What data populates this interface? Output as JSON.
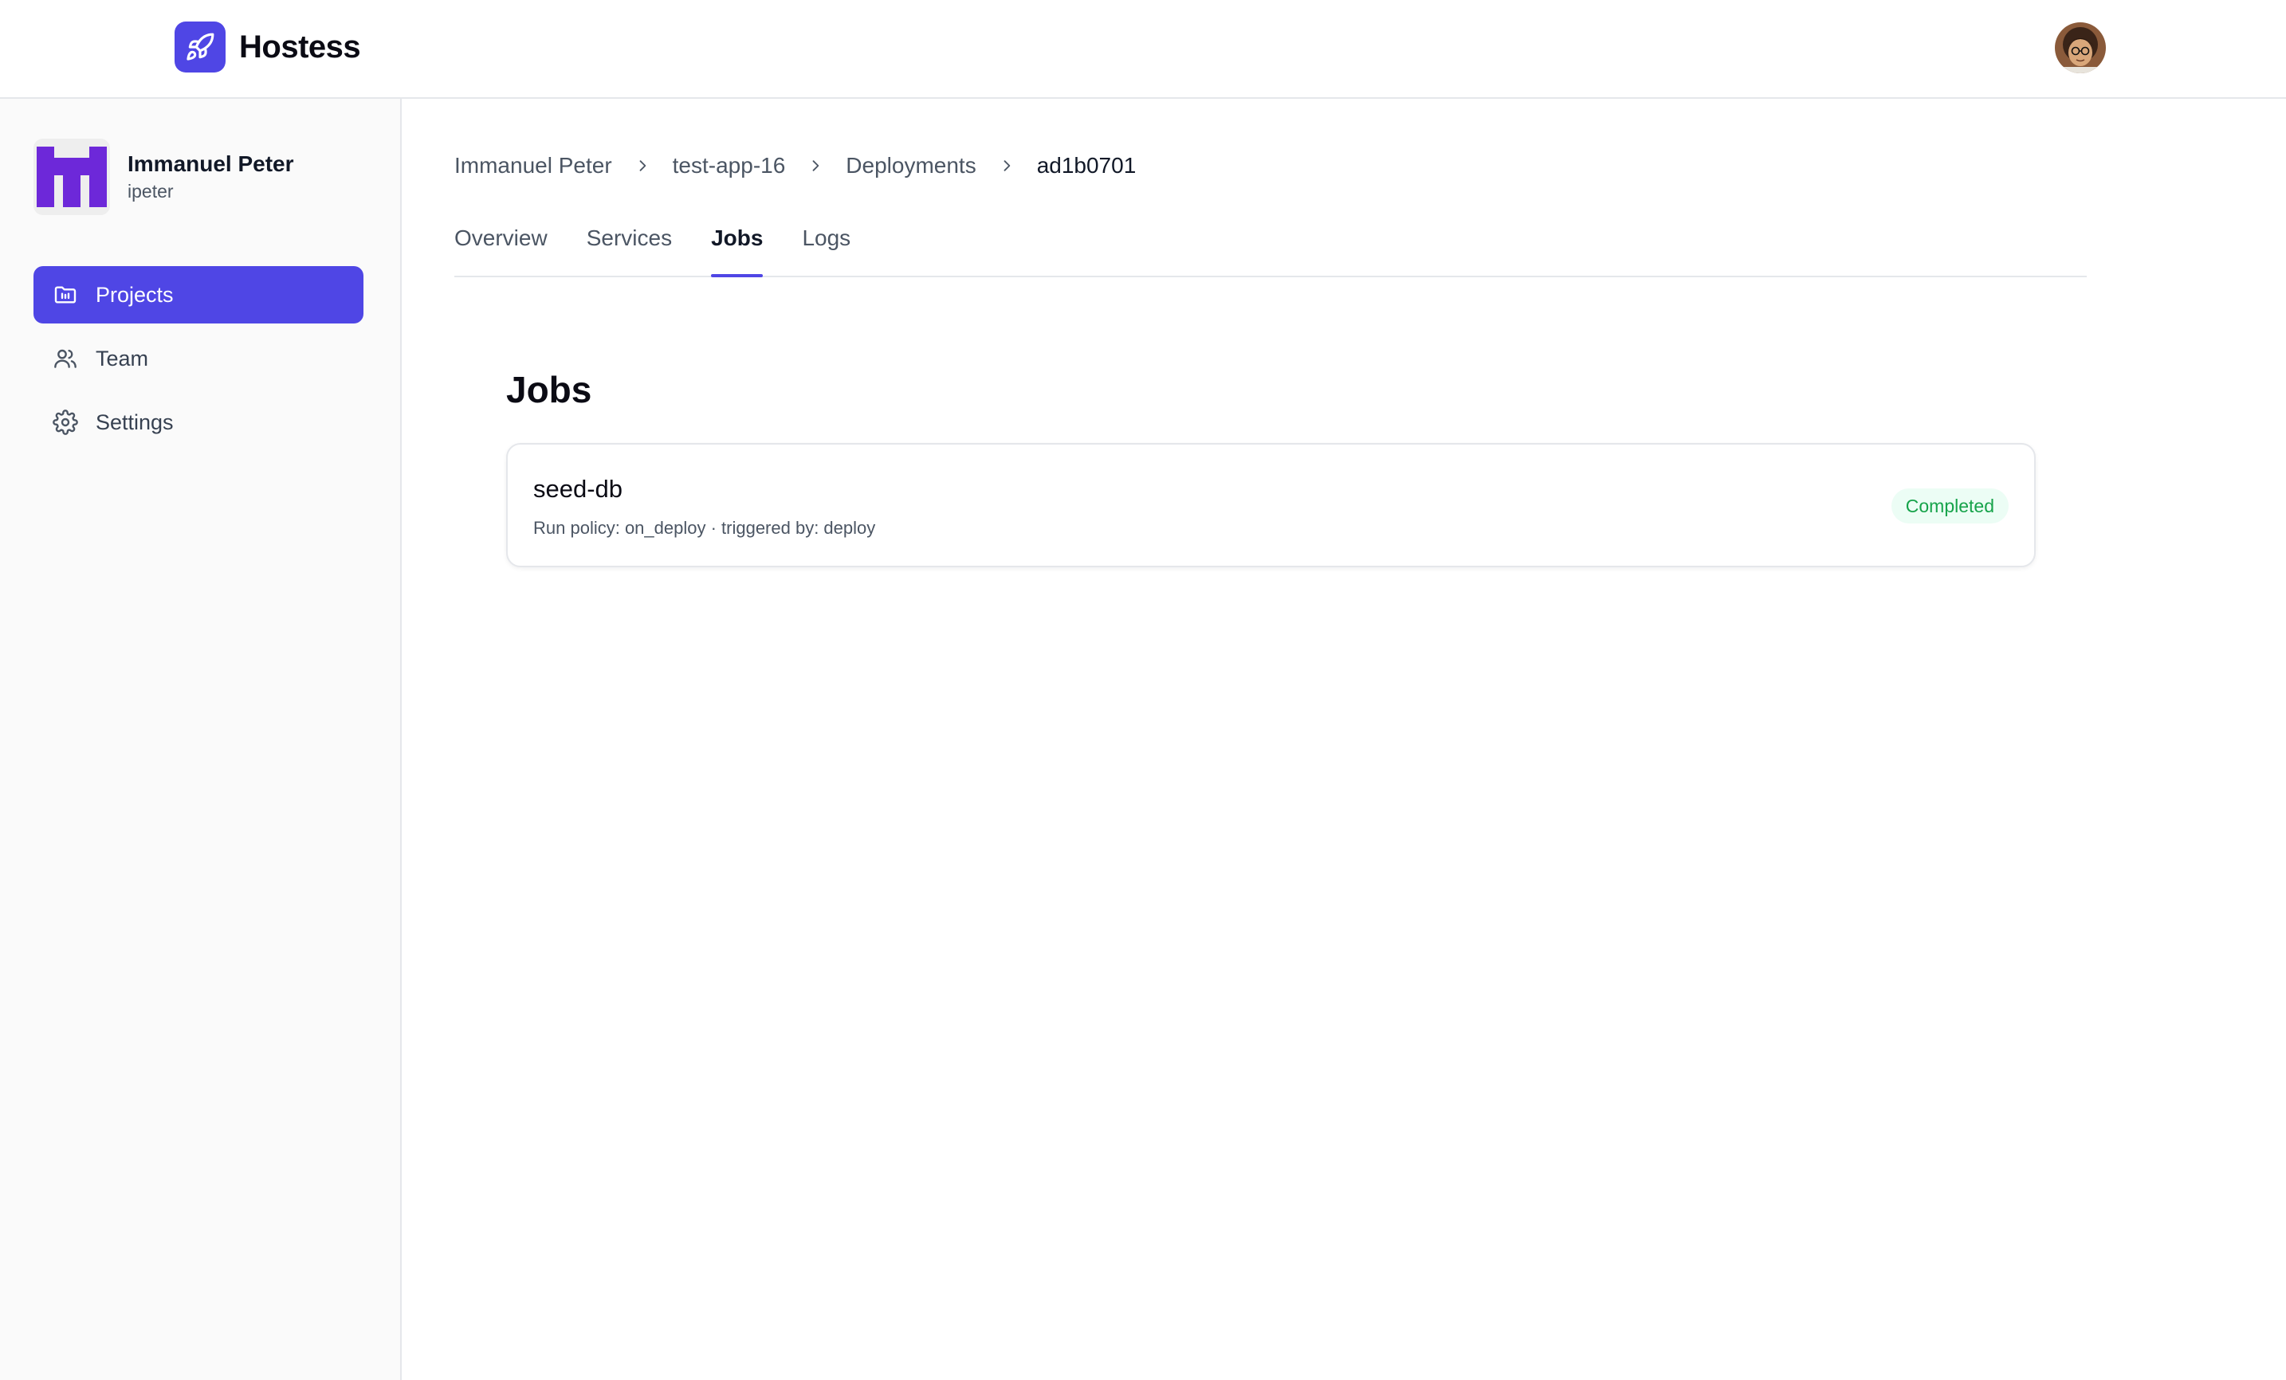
{
  "app": {
    "name": "Hostess",
    "brand_color": "#4f46e5"
  },
  "header": {
    "logo_icon": "rocket-icon",
    "user_avatar_icon": "user-avatar-photo"
  },
  "sidebar": {
    "account": {
      "name": "Immanuel Peter",
      "handle": "ipeter",
      "avatar_color": "#6d28d9"
    },
    "items": [
      {
        "label": "Projects",
        "icon": "folder-icon",
        "active": true
      },
      {
        "label": "Team",
        "icon": "users-icon",
        "active": false
      },
      {
        "label": "Settings",
        "icon": "gear-icon",
        "active": false
      }
    ]
  },
  "breadcrumb": [
    "Immanuel Peter",
    "test-app-16",
    "Deployments",
    "ad1b0701"
  ],
  "tabs": [
    {
      "label": "Overview",
      "active": false
    },
    {
      "label": "Services",
      "active": false
    },
    {
      "label": "Jobs",
      "active": true
    },
    {
      "label": "Logs",
      "active": false
    }
  ],
  "main": {
    "title": "Jobs",
    "jobs": [
      {
        "name": "seed-db",
        "meta": "Run policy: on_deploy · triggered by: deploy",
        "status": "Completed",
        "status_color": "#16a34a"
      }
    ]
  }
}
